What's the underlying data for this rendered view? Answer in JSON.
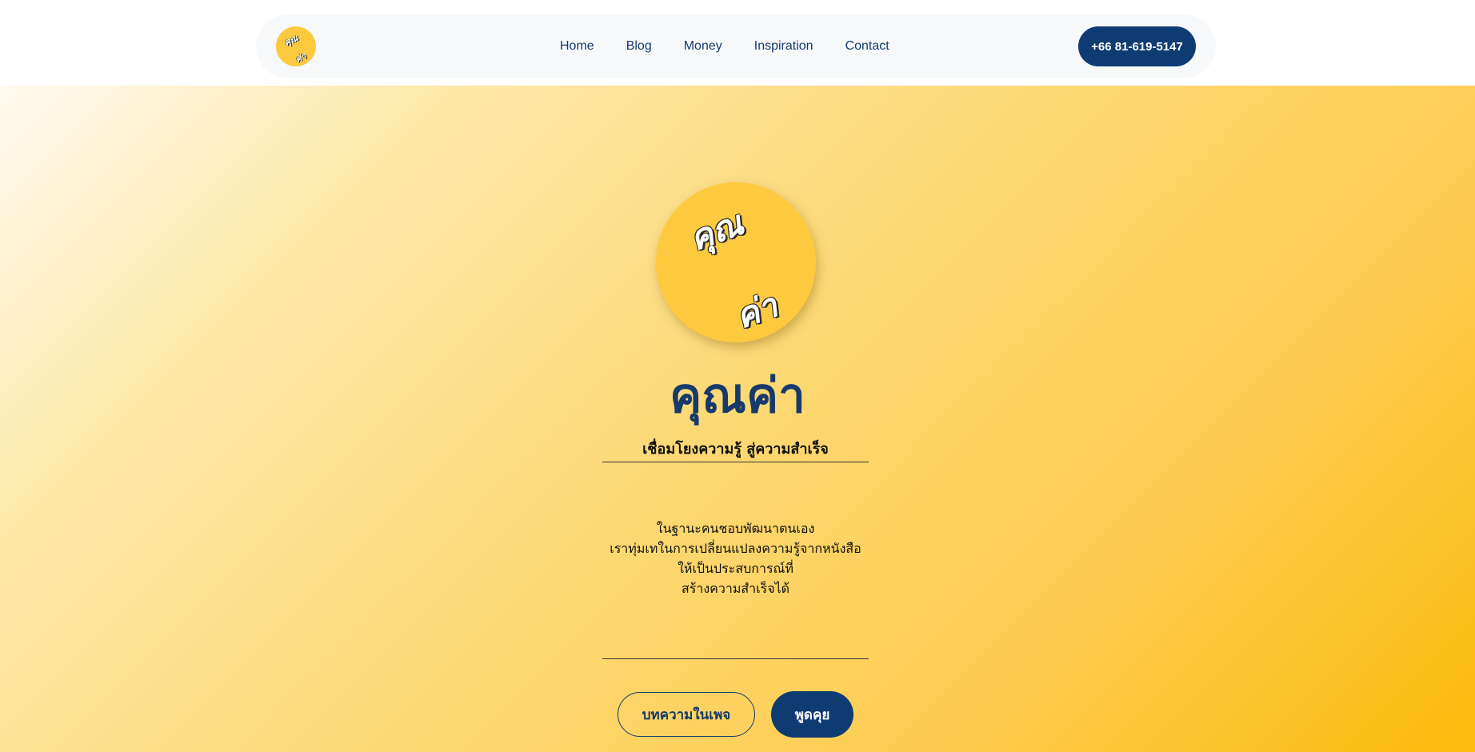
{
  "header": {
    "logo_text": [
      "คุณ",
      "ค่า"
    ],
    "nav": [
      {
        "label": "Home"
      },
      {
        "label": "Blog"
      },
      {
        "label": "Money"
      },
      {
        "label": "Inspiration"
      },
      {
        "label": "Contact"
      }
    ],
    "phone_label": "+66 81-619-5147"
  },
  "hero": {
    "logo_text": [
      "คุณ",
      "ค่า"
    ],
    "title": "คุณค่า",
    "subtitle": "เชื่อมโยงความรู้ สู่ความสำเร็จ",
    "description_lines": [
      "ในฐานะคนชอบพัฒนาตนเอง",
      "เราทุ่มเทในการเปลี่ยนแปลงความรู้จากหนังสือ",
      "ให้เป็นประสบการณ์ที่",
      "สร้างความสำเร็จได้"
    ],
    "buttons": {
      "articles_label": "บทความในเพจ",
      "talk_label": "พูดคุย"
    }
  },
  "colors": {
    "brand_navy": "#0f3b73",
    "brand_yellow": "#fdc93f",
    "nav_bg": "#f6f8fa",
    "gradient_end": "#fcba0a"
  }
}
